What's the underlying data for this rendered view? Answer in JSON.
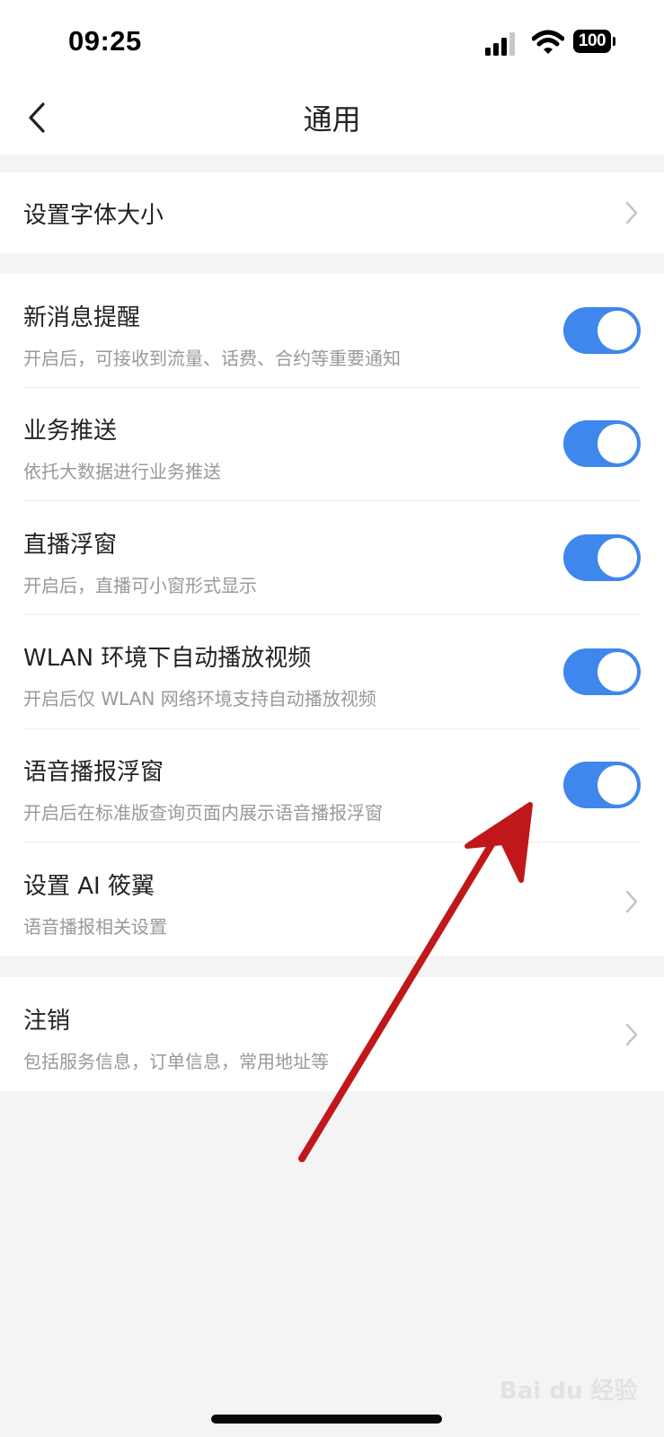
{
  "status_bar": {
    "time": "09:25",
    "battery": "100",
    "icons": [
      "signal-icon",
      "wifi-icon",
      "battery-icon"
    ]
  },
  "nav": {
    "title": "通用",
    "back_icon": "chevron-left-icon"
  },
  "font_size_row": {
    "title": "设置字体大小"
  },
  "toggle_rows": [
    {
      "title": "新消息提醒",
      "subtitle": "开启后，可接收到流量、话费、合约等重要通知",
      "on": true
    },
    {
      "title": "业务推送",
      "subtitle": "依托大数据进行业务推送",
      "on": true
    },
    {
      "title": "直播浮窗",
      "subtitle": "开启后，直播可小窗形式显示",
      "on": true
    },
    {
      "title": "WLAN 环境下自动播放视频",
      "subtitle": "开启后仅 WLAN 网络环境支持自动播放视频",
      "on": true
    },
    {
      "title": "语音播报浮窗",
      "subtitle": "开启后在标准版查询页面内展示语音播报浮窗",
      "on": true
    }
  ],
  "ai_row": {
    "title": "设置 AI 筱翼",
    "subtitle": "语音播报相关设置"
  },
  "cancel_row": {
    "title": "注销",
    "subtitle": "包括服务信息，订单信息，常用地址等"
  },
  "watermark": "Bai du 经验",
  "colors": {
    "toggle_on": "#3f87ec",
    "annotation_arrow": "#c0171a",
    "background": "#f4f4f4"
  }
}
